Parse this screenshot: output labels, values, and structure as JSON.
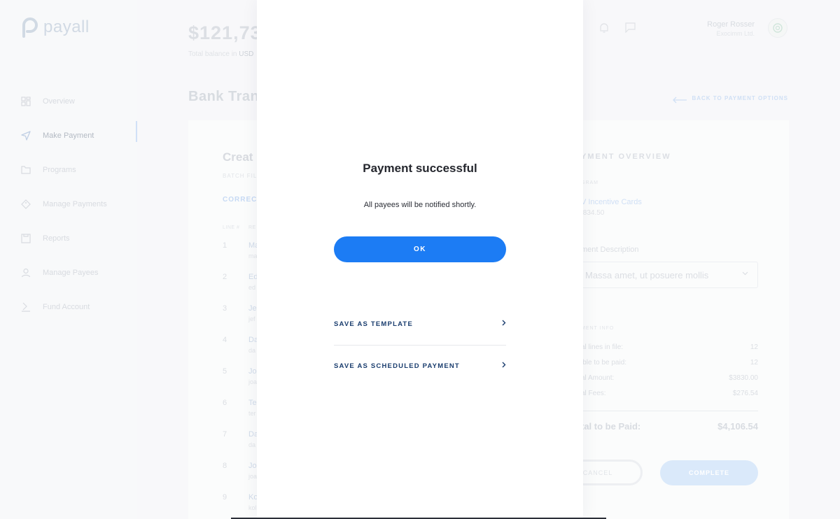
{
  "app": {
    "logo_text": "payall"
  },
  "sidebar": {
    "items": [
      {
        "label": "Overview",
        "icon": "grid-icon"
      },
      {
        "label": "Make Payment",
        "icon": "send-icon",
        "active": true
      },
      {
        "label": "Programs",
        "icon": "folder-icon"
      },
      {
        "label": "Manage Payments",
        "icon": "tag-icon"
      },
      {
        "label": "Reports",
        "icon": "report-icon"
      },
      {
        "label": "Manage Payees",
        "icon": "user-icon"
      },
      {
        "label": "Fund Account",
        "icon": "fund-icon"
      }
    ]
  },
  "header": {
    "balance": "$121,73",
    "balance_caption": "Total balance in ",
    "balance_currency": "USD",
    "user_name": "Roger Rosser",
    "user_company": "Exocimm Ltd."
  },
  "page": {
    "title": "Bank Tran",
    "back_link": "BACK TO PAYMENT OPTIONS"
  },
  "batch": {
    "title": "Creat",
    "subtitle": "BATCH FIL",
    "tab": "CORRECT",
    "col_line": "LINE #",
    "col_recipient": "RE",
    "rows": [
      {
        "num": "1",
        "name": "Ma",
        "email": "ma"
      },
      {
        "num": "2",
        "name": "Ed",
        "email": "ed"
      },
      {
        "num": "3",
        "name": "Je",
        "email": "jef"
      },
      {
        "num": "4",
        "name": "Da",
        "email": "da"
      },
      {
        "num": "5",
        "name": "Jo",
        "email": "joa"
      },
      {
        "num": "6",
        "name": "Te",
        "email": "ter"
      },
      {
        "num": "7",
        "name": "Da",
        "email": "da"
      },
      {
        "num": "8",
        "name": "Jo",
        "email": "joa"
      },
      {
        "num": "9",
        "name": "Ko",
        "email": "kol"
      }
    ]
  },
  "overview": {
    "title": "YMENT OVERVIEW",
    "program_label": "GRAM",
    "program_name": "V Incentive Cards",
    "program_amount": ",834.50",
    "desc_label": "ment Description",
    "desc_value": "Massa amet, ut posuere mollis",
    "info_label": "MENT INFO",
    "info_rows": [
      {
        "label": "al lines in file:",
        "value": "12"
      },
      {
        "label": "ible to be paid:",
        "value": "12"
      },
      {
        "label": "al Amount:",
        "value": "$3830.00"
      },
      {
        "label": "al Fees:",
        "value": "$276.54"
      }
    ],
    "total_label": "tal to be Paid:",
    "total_value": "$4,106.54",
    "cancel_label": "CANCEL",
    "complete_label": "COMPLETE"
  },
  "modal": {
    "title": "Payment successful",
    "message": "All payees will be notified shortly.",
    "ok_label": "OK",
    "link_template": "SAVE AS TEMPLATE",
    "link_scheduled": "SAVE AS SCHEDULED PAYMENT"
  },
  "colors": {
    "primary": "#1c7cf4",
    "link_text": "#1a3d6e",
    "title_text": "#25272e"
  }
}
